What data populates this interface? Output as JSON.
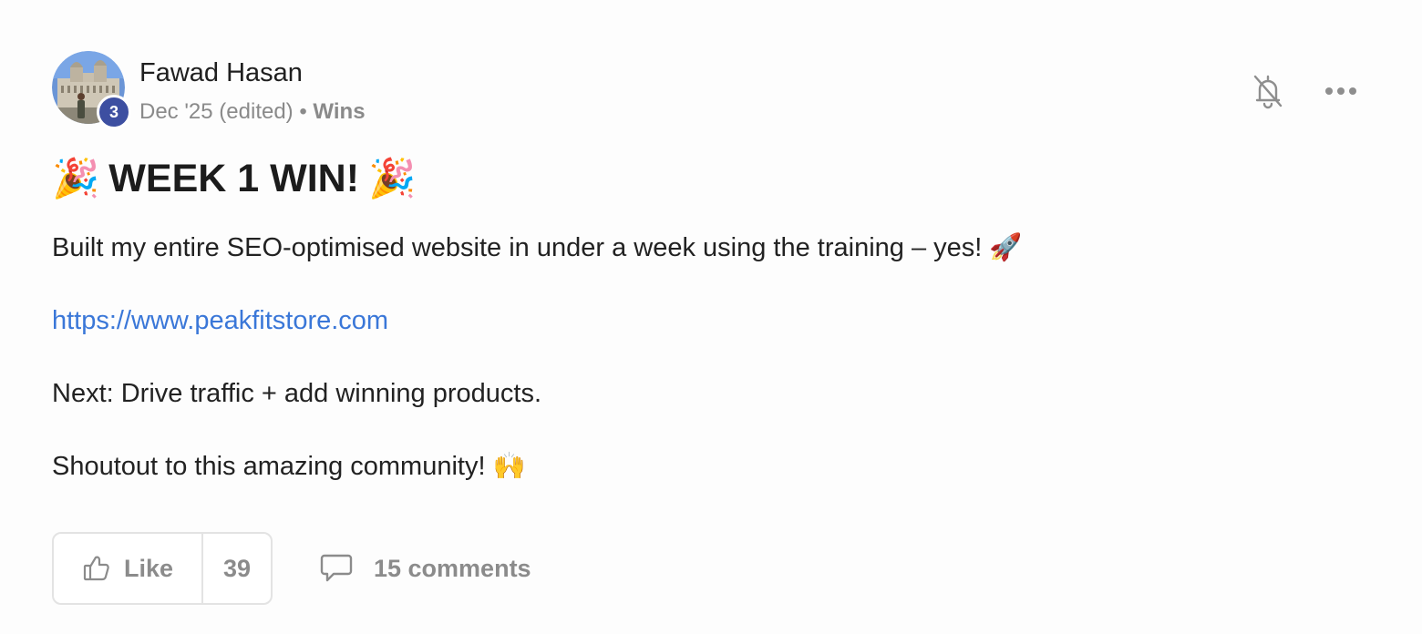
{
  "author": {
    "name": "Fawad Hasan",
    "level": "3",
    "avatar_icon": "profile-photo-cathedral"
  },
  "meta": {
    "date": "Dec '25 (edited)",
    "separator": "•",
    "category": "Wins"
  },
  "actions": {
    "bell_icon": "bell-off-icon",
    "more_icon": "ellipsis-icon"
  },
  "post": {
    "title_emoji": "🎉",
    "title": "WEEK 1 WIN!",
    "paragraph1": "Built my entire SEO-optimised website in under a week using the training – yes! 🚀",
    "link": "https://www.peakfitstore.com",
    "paragraph3": "Next: Drive traffic + add winning products.",
    "paragraph4": "Shoutout to this amazing community! 🙌"
  },
  "footer": {
    "like_label": "Like",
    "like_count": "39",
    "comments_label": "15 comments"
  },
  "colors": {
    "link": "#3a77d8",
    "badge": "#3d4fa1",
    "muted": "#8b8b8b"
  }
}
